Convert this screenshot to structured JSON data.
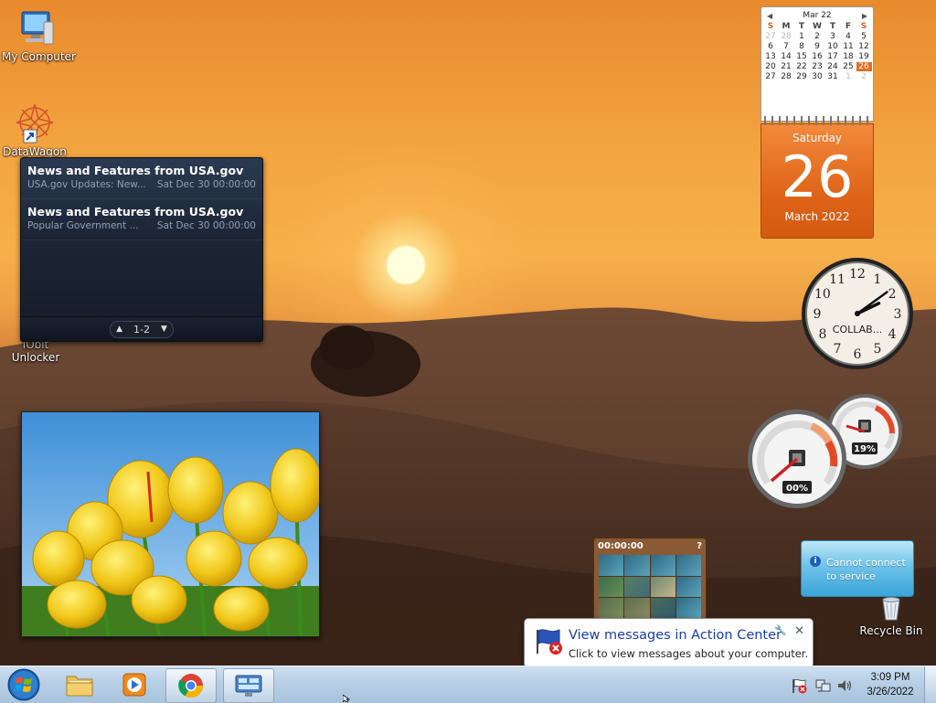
{
  "desktop": {
    "icons": {
      "my_computer": "My Computer",
      "datawagon": "DataWagon",
      "iobit": "IObit",
      "unlocker": "Unlocker",
      "recycle_bin": "Recycle Bin"
    }
  },
  "feed_gadget": {
    "items": [
      {
        "title": "News and Features from USA.gov",
        "summary": "USA.gov Updates: New...",
        "date": "Sat Dec 30 00:00:00"
      },
      {
        "title": "News and Features from USA.gov",
        "summary": "Popular Government ...",
        "date": "Sat Dec 30 00:00:00"
      }
    ],
    "page": "1-2"
  },
  "calendar_gadget": {
    "month_label": "Mar 22",
    "weekdays": [
      "S",
      "M",
      "T",
      "W",
      "T",
      "F",
      "S"
    ],
    "weeks": [
      [
        "27",
        "28",
        "1",
        "2",
        "3",
        "4",
        "5"
      ],
      [
        "6",
        "7",
        "8",
        "9",
        "10",
        "11",
        "12"
      ],
      [
        "13",
        "14",
        "15",
        "16",
        "17",
        "18",
        "19"
      ],
      [
        "20",
        "21",
        "22",
        "23",
        "24",
        "25",
        "26"
      ],
      [
        "27",
        "28",
        "29",
        "30",
        "31",
        "1",
        "2"
      ]
    ],
    "day_name": "Saturday",
    "day_number": "26",
    "month_year": "March 2022"
  },
  "clock_gadget": {
    "label": "COLLAB...",
    "numerals": [
      "12",
      "1",
      "2",
      "3",
      "4",
      "5",
      "6",
      "7",
      "8",
      "9",
      "10",
      "11"
    ],
    "time_hour": 2,
    "time_minute": 9
  },
  "cpu_meter": {
    "cpu": "00%",
    "memory": "19%",
    "cpu_value": 0,
    "memory_value": 19
  },
  "puzzle_gadget": {
    "timer": "00:00:00"
  },
  "service_gadget": {
    "message_line1": "Cannot connect",
    "message_line2": "to service"
  },
  "action_center_balloon": {
    "title": "View messages in Action Center",
    "body": "Click to view messages about your computer."
  },
  "taskbar": {
    "time": "3:09 PM",
    "date": "3/26/2022"
  },
  "colors": {
    "calendar_accent": "#e46e1e",
    "balloon_title": "#1a3ea6"
  }
}
